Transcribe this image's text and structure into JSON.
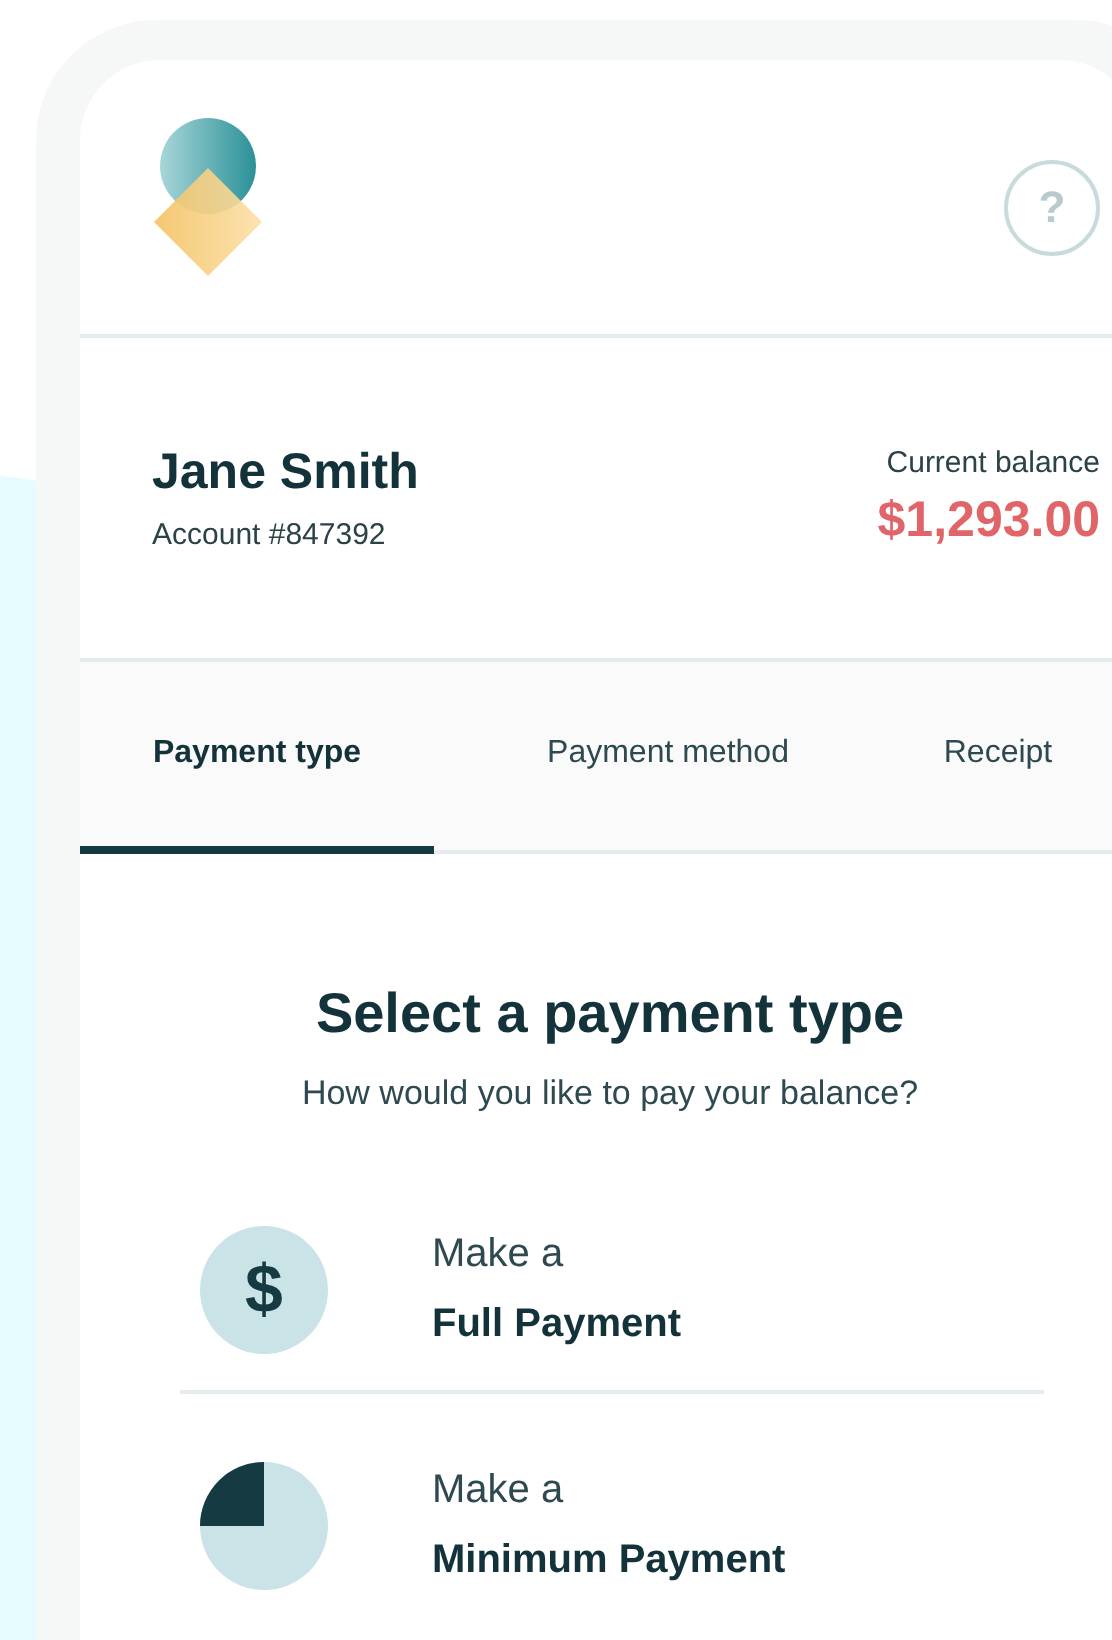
{
  "header": {
    "help_label": "?"
  },
  "account": {
    "name": "Jane Smith",
    "number": "Account #847392",
    "balance_label": "Current balance",
    "balance": "$1,293.00"
  },
  "tabs": [
    {
      "label": "Payment type",
      "selected": true
    },
    {
      "label": "Payment method",
      "selected": false
    },
    {
      "label": "Receipt",
      "selected": false
    }
  ],
  "heading": "Select a payment type",
  "subheading": "How would you like to pay your balance?",
  "options": [
    {
      "kind": "full",
      "symbol": "$",
      "prefix": "Make a",
      "title": "Full Payment"
    },
    {
      "kind": "minimum",
      "prefix": "Make a",
      "title": "Minimum Payment"
    }
  ]
}
